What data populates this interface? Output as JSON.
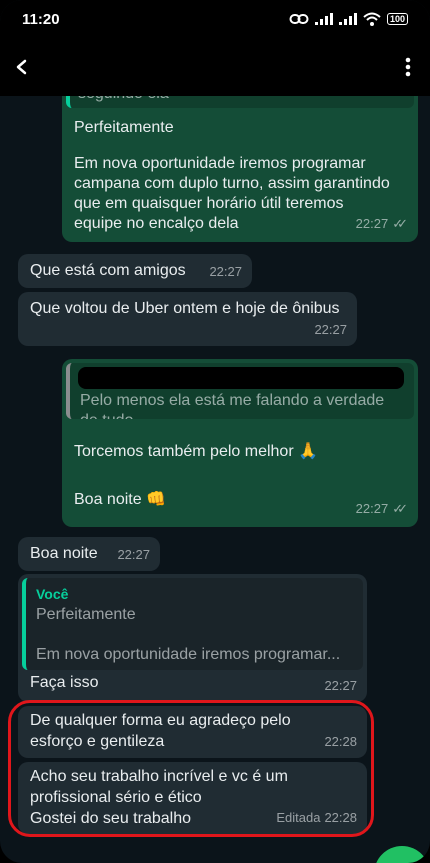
{
  "status": {
    "time": "11:20",
    "battery": "100"
  },
  "icons": {
    "back": "arrow-left-icon",
    "menu": "more-vertical-icon",
    "link": "link-icon",
    "signal": "signal-icon",
    "wifi": "wifi-icon",
    "battery": "battery-icon"
  },
  "colors": {
    "outgoing_bubble": "#144d37",
    "incoming_bubble": "#202c33",
    "quote_accent": "#06cf9c",
    "highlight_border": "#e0161b"
  },
  "messages": [
    {
      "direction": "outgoing",
      "quote_partial": "seguindo ela",
      "text_1": "Perfeitamente",
      "text_2": "Em nova oportunidade iremos programar campana com duplo turno, assim garantindo que em quaisquer horário útil teremos equipe no encalço dela",
      "time": "22:27"
    },
    {
      "direction": "incoming",
      "text": "Que está com amigos",
      "time": "22:27"
    },
    {
      "direction": "incoming",
      "text": "Que voltou de Uber ontem e hoje de ônibus",
      "time": "22:27"
    },
    {
      "direction": "outgoing",
      "quote_text": "Pelo menos ela está me falando a verdade de tudo",
      "text_1": "Torcemos também pelo melhor 🙏",
      "text_2": "Boa noite 👊",
      "time": "22:27"
    },
    {
      "direction": "incoming",
      "text": "Boa noite",
      "time": "22:27"
    },
    {
      "direction": "incoming",
      "quote_author": "Você",
      "quote_line_1": "Perfeitamente",
      "quote_line_2": "Em nova oportunidade iremos programar...",
      "text": "Faça isso",
      "time": "22:27"
    },
    {
      "direction": "incoming",
      "text": "De qualquer forma eu agradeço pelo esforço e gentileza",
      "time": "22:28"
    },
    {
      "direction": "incoming",
      "text_1": "Acho seu trabalho incrível e vc é um profissional sério e ético",
      "text_2": "Gostei do seu trabalho",
      "edited_label": "Editada",
      "time": "22:28"
    }
  ]
}
